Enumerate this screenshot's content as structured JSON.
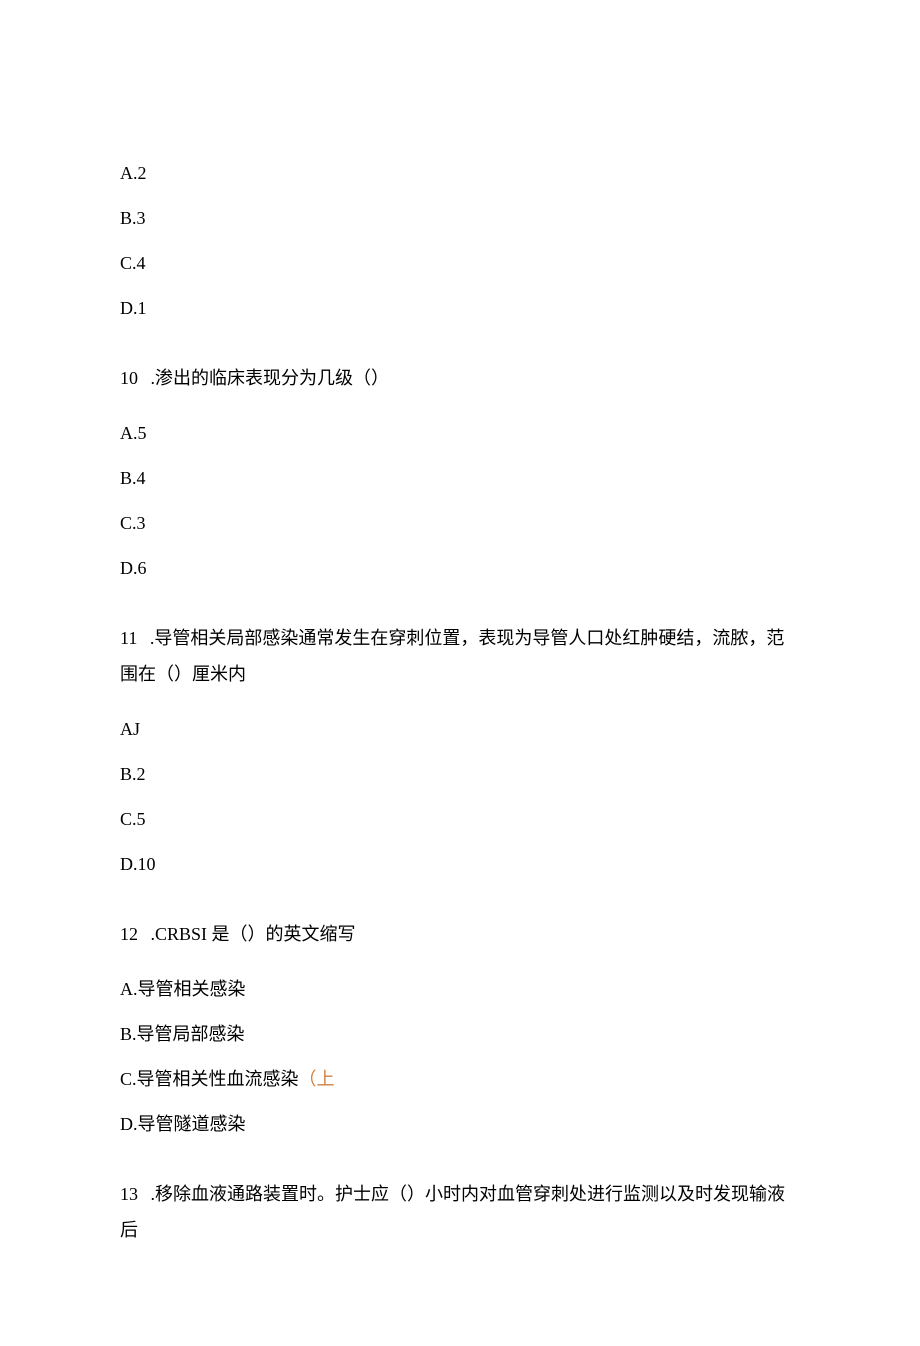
{
  "q9_tail": {
    "options": [
      {
        "label": "A.2"
      },
      {
        "label": "B.3"
      },
      {
        "label": "C.4"
      },
      {
        "label": "D.1"
      }
    ]
  },
  "q10": {
    "num": "10",
    "stem": " .渗出的临床表现分为几级（）",
    "options": [
      {
        "label": "A.5"
      },
      {
        "label": "B.4"
      },
      {
        "label": "C.3"
      },
      {
        "label": "D.6"
      }
    ]
  },
  "q11": {
    "num": "11",
    "stem": " .导管相关局部感染通常发生在穿刺位置，表现为导管人口处红肿硬结，流脓，范围在（）厘米内",
    "options": [
      {
        "label": "AJ"
      },
      {
        "label": "B.2"
      },
      {
        "label": "C.5"
      },
      {
        "label": "D.10"
      }
    ]
  },
  "q12": {
    "num": "12",
    "stem": " .CRBSI 是（）的英文缩写",
    "options": [
      {
        "label": "A.导管相关感染"
      },
      {
        "label": "B.导管局部感染"
      },
      {
        "label_main": "C.导管相关性血流感染",
        "annotation": "（上"
      },
      {
        "label": "D.导管隧道感染"
      }
    ]
  },
  "q13": {
    "num": "13",
    "stem": " .移除血液通路装置时。护士应（）小时内对血管穿刺处进行监测以及时发现输液后"
  }
}
